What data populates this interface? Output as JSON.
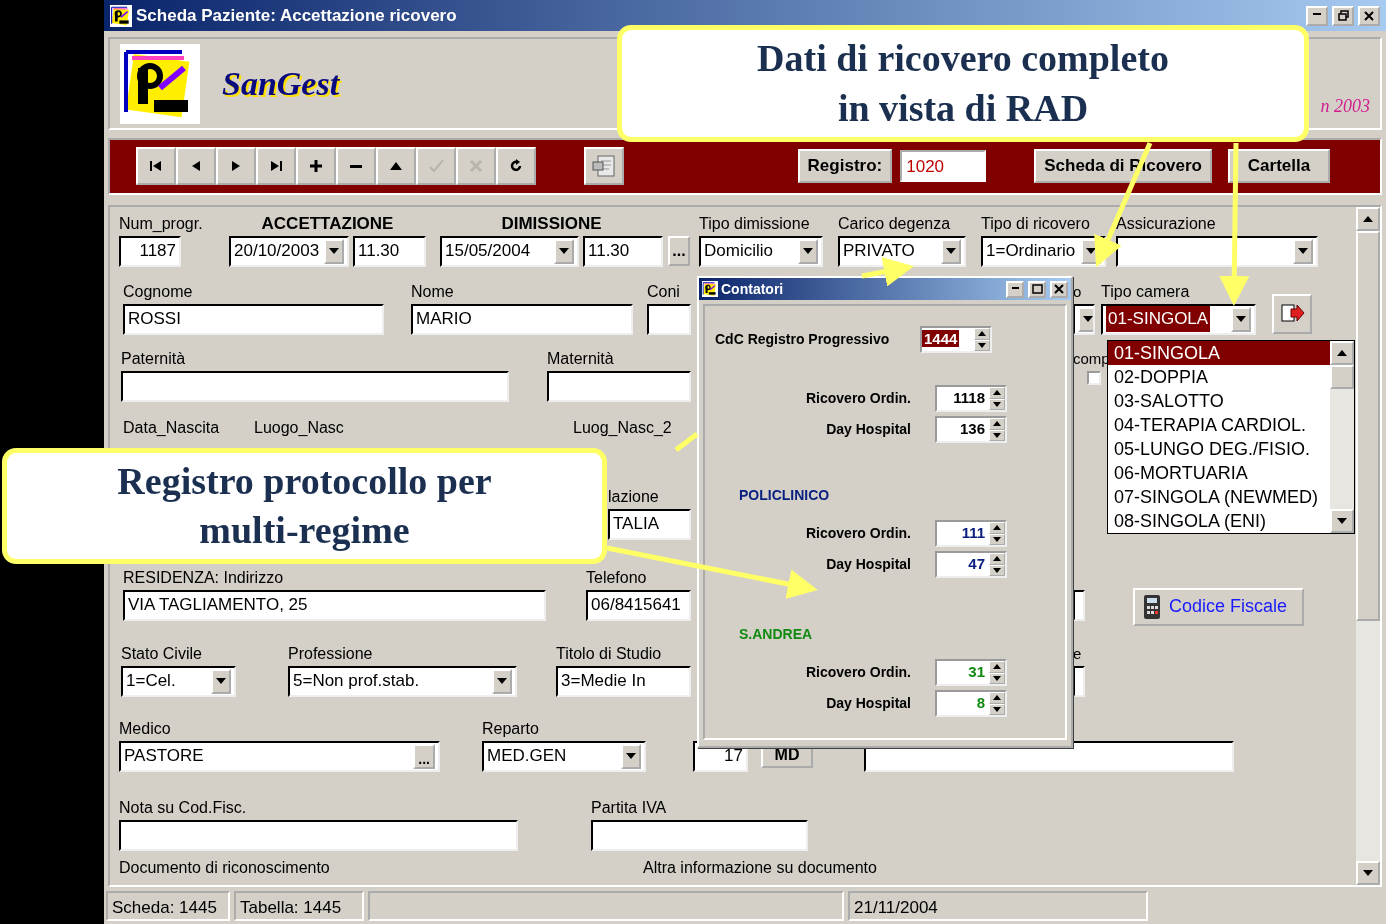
{
  "window": {
    "title": "Scheda Paziente: Accettazione ricovero"
  },
  "header": {
    "app_name": "SanGest",
    "version_fragment": "n 2003"
  },
  "toolbar": {
    "nav_buttons": [
      {
        "kind": "first",
        "disabled": false
      },
      {
        "kind": "prev",
        "disabled": false
      },
      {
        "kind": "next",
        "disabled": false
      },
      {
        "kind": "last",
        "disabled": false
      },
      {
        "kind": "add",
        "disabled": false
      },
      {
        "kind": "delete",
        "disabled": false
      },
      {
        "kind": "up",
        "disabled": false
      },
      {
        "kind": "confirm",
        "disabled": true
      },
      {
        "kind": "cancel",
        "disabled": true
      },
      {
        "kind": "refresh",
        "disabled": false
      }
    ],
    "registro_label": "Registro:",
    "registro_value": "1020",
    "buttons": [
      "Scheda di Ricovero",
      "Cartella"
    ]
  },
  "form": {
    "rows": [
      {
        "fields": [
          {
            "kind": "number",
            "label": "Num_progr.",
            "value": "1187"
          },
          {
            "kind": "datetime",
            "label": "ACCETTAZIONE",
            "date": "20/10/2003",
            "time": "11.30"
          },
          {
            "kind": "datetime",
            "label": "DIMISSIONE",
            "date": "15/05/2004",
            "time": "11.30"
          },
          {
            "kind": "button",
            "text": "..."
          },
          {
            "kind": "combo",
            "label": "Tipo dimissione",
            "value": "Domicilio"
          },
          {
            "kind": "combo",
            "label": "Carico degenza",
            "value": "PRIVATO"
          },
          {
            "kind": "combo",
            "label": "Tipo di ricovero",
            "value": "1=Ordinario"
          },
          {
            "kind": "combo",
            "label": "Assicurazione"
          }
        ]
      },
      {
        "fields": [
          {
            "kind": "text",
            "label": "Cognome",
            "value": "ROSSI"
          },
          {
            "kind": "text",
            "label": "Nome",
            "value": "MARIO"
          },
          {
            "kind": "text",
            "label": "Coni"
          },
          {
            "kind": "combo",
            "label": "o"
          },
          {
            "kind": "combo",
            "label": "Tipo camera",
            "value": "01-SINGOLA",
            "selected": true
          },
          {
            "kind": "icon-button"
          }
        ]
      },
      {
        "fields": [
          {
            "kind": "text",
            "label": "Paternità"
          },
          {
            "kind": "text",
            "label": "Maternità"
          },
          {
            "kind": "checkbox",
            "label": "comp",
            "checked": false
          }
        ]
      },
      {
        "fields": [
          {
            "kind": "label",
            "label": "Data_Nascita"
          },
          {
            "kind": "label",
            "label": "Luogo_Nasc"
          },
          {
            "kind": "label",
            "label": "Luog_Nasc_2"
          }
        ]
      },
      {
        "fields": [
          {
            "kind": "text",
            "label": "lazione",
            "value": "TALIA"
          }
        ]
      },
      {
        "fields": [
          {
            "kind": "text",
            "label": "RESIDENZA: Indirizzo",
            "value": "VIA TAGLIAMENTO, 25"
          },
          {
            "kind": "text",
            "label": "Telefono",
            "value": "06/8415641"
          },
          {
            "kind": "text"
          },
          {
            "kind": "calc-button",
            "text": "Codice Fiscale"
          }
        ]
      },
      {
        "fields": [
          {
            "kind": "combo",
            "label": "Stato Civile",
            "value": "1=Cel."
          },
          {
            "kind": "combo",
            "label": "Professione",
            "value": "5=Non prof.stab."
          },
          {
            "kind": "text",
            "label": "Titolo di Studio",
            "value": "3=Medie In"
          },
          {
            "kind": "text",
            "label": "e"
          }
        ]
      },
      {
        "fields": [
          {
            "kind": "lookup",
            "label": "Medico",
            "value": "PASTORE",
            "button": "..."
          },
          {
            "kind": "combo",
            "label": "Reparto",
            "value": "MED.GEN"
          },
          {
            "kind": "number",
            "value": "17"
          },
          {
            "kind": "button",
            "text": "MD"
          },
          {
            "kind": "text"
          }
        ]
      },
      {
        "fields": [
          {
            "kind": "text",
            "label": "Nota su Cod.Fisc."
          },
          {
            "kind": "text",
            "label": "Partita IVA"
          }
        ]
      },
      {
        "fields": [
          {
            "kind": "label",
            "label": "Documento di riconoscimento"
          },
          {
            "kind": "label",
            "label": "Altra informazione su documento"
          }
        ]
      }
    ]
  },
  "room_dropdown": {
    "items": [
      {
        "label": "01-SINGOLA",
        "selected": true
      },
      {
        "label": "02-DOPPIA",
        "selected": false
      },
      {
        "label": "03-SALOTTO",
        "selected": false
      },
      {
        "label": "04-TERAPIA CARDIOL.",
        "selected": false
      },
      {
        "label": "05-LUNGO DEG./FISIO.",
        "selected": false
      },
      {
        "label": "06-MORTUARIA",
        "selected": false
      },
      {
        "label": "07-SINGOLA (NEWMED)",
        "selected": false
      },
      {
        "label": "08-SINGOLA (ENI)",
        "selected": false
      }
    ]
  },
  "counter_dialog": {
    "title": "Contatori",
    "main_label": "CdC Registro Progressivo",
    "main_value": "1444",
    "groups": [
      {
        "color": "#000000",
        "counters": [
          {
            "label": "Ricovero Ordin.",
            "value": "1118"
          },
          {
            "label": "Day Hospital",
            "value": "136"
          }
        ]
      },
      {
        "heading": "POLICLINICO",
        "color": "#0a2080",
        "counters": [
          {
            "label": "Ricovero Ordin.",
            "value": "111"
          },
          {
            "label": "Day Hospital",
            "value": "47"
          }
        ]
      },
      {
        "heading": "S.ANDREA",
        "color": "#108a10",
        "counters": [
          {
            "label": "Ricovero Ordin.",
            "value": "31"
          },
          {
            "label": "Day Hospital",
            "value": "8"
          }
        ]
      }
    ]
  },
  "callouts": [
    {
      "text": "Dati di ricovero completo in vista di RAD"
    },
    {
      "text": "Registro protocollo per multi-regime"
    }
  ],
  "status_bar": {
    "panels": [
      "Scheda:  1445",
      "Tabella:  1445",
      "21/11/2004"
    ]
  }
}
